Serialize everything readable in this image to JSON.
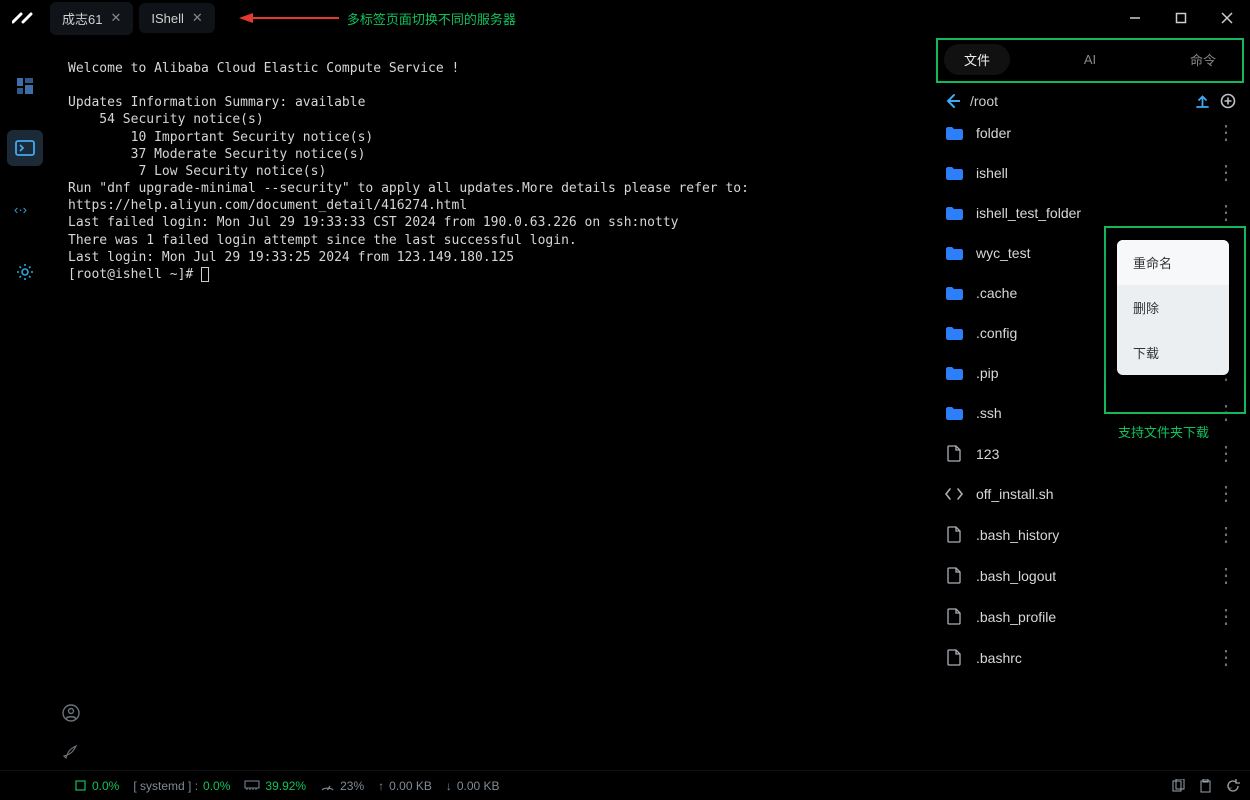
{
  "tabs": {
    "items": [
      {
        "label": "成志61",
        "active": false
      },
      {
        "label": "IShell",
        "active": true
      }
    ]
  },
  "annotations": {
    "tabs_note": "多标签页面切换不同的服务器",
    "download_note": "支持文件夹下载"
  },
  "terminal": {
    "lines": [
      "Welcome to Alibaba Cloud Elastic Compute Service !",
      "",
      "Updates Information Summary: available",
      "    54 Security notice(s)",
      "        10 Important Security notice(s)",
      "        37 Moderate Security notice(s)",
      "         7 Low Security notice(s)",
      "Run \"dnf upgrade-minimal --security\" to apply all updates.More details please refer to:",
      "https://help.aliyun.com/document_detail/416274.html",
      "Last failed login: Mon Jul 29 19:33:33 CST 2024 from 190.0.63.226 on ssh:notty",
      "There was 1 failed login attempt since the last successful login.",
      "Last login: Mon Jul 29 19:33:25 2024 from 123.149.180.125"
    ],
    "prompt": "[root@ishell ~]# "
  },
  "right_panel": {
    "tabs": [
      {
        "label": "文件",
        "active": true
      },
      {
        "label": "AI",
        "active": false
      },
      {
        "label": "命令",
        "active": false
      }
    ],
    "path": "/root",
    "files": [
      {
        "name": "folder",
        "kind": "folder"
      },
      {
        "name": "ishell",
        "kind": "folder"
      },
      {
        "name": "ishell_test_folder",
        "kind": "folder"
      },
      {
        "name": "wyc_test",
        "kind": "folder"
      },
      {
        "name": ".cache",
        "kind": "folder"
      },
      {
        "name": ".config",
        "kind": "folder"
      },
      {
        "name": ".pip",
        "kind": "folder"
      },
      {
        "name": ".ssh",
        "kind": "folder"
      },
      {
        "name": "123",
        "kind": "file"
      },
      {
        "name": "off_install.sh",
        "kind": "code"
      },
      {
        "name": ".bash_history",
        "kind": "file"
      },
      {
        "name": ".bash_logout",
        "kind": "file"
      },
      {
        "name": ".bash_profile",
        "kind": "file"
      },
      {
        "name": ".bashrc",
        "kind": "file"
      }
    ],
    "context_menu": [
      {
        "label": "重命名",
        "hover": true
      },
      {
        "label": "删除",
        "hover": false
      },
      {
        "label": "下载",
        "hover": false
      }
    ]
  },
  "statusbar": {
    "cpu": "0.0%",
    "systemd_label": "[ systemd ] :",
    "systemd_value": "0.0%",
    "memory": "39.92%",
    "disk": "23%",
    "up": "0.00 KB",
    "down": "0.00 KB",
    "dash": "-"
  }
}
